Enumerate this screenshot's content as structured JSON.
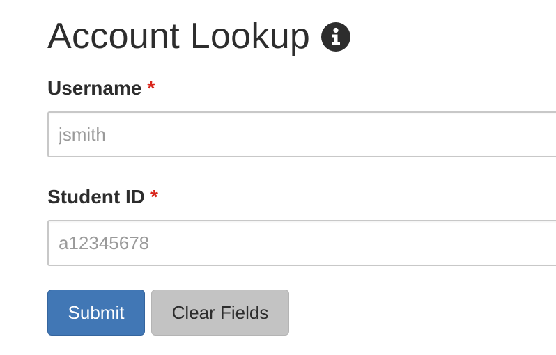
{
  "header": {
    "title": "Account Lookup",
    "info_icon": "info-circle-icon"
  },
  "form": {
    "username": {
      "label": "Username",
      "required_marker": "*",
      "value": "",
      "placeholder": "jsmith"
    },
    "student_id": {
      "label": "Student ID",
      "required_marker": "*",
      "value": "",
      "placeholder": "a12345678"
    }
  },
  "actions": {
    "submit_label": "Submit",
    "clear_label": "Clear Fields"
  },
  "colors": {
    "primary_button": "#4177b5",
    "secondary_button": "#c3c3c3",
    "required_asterisk": "#d9261c",
    "text": "#2d2d2d"
  }
}
